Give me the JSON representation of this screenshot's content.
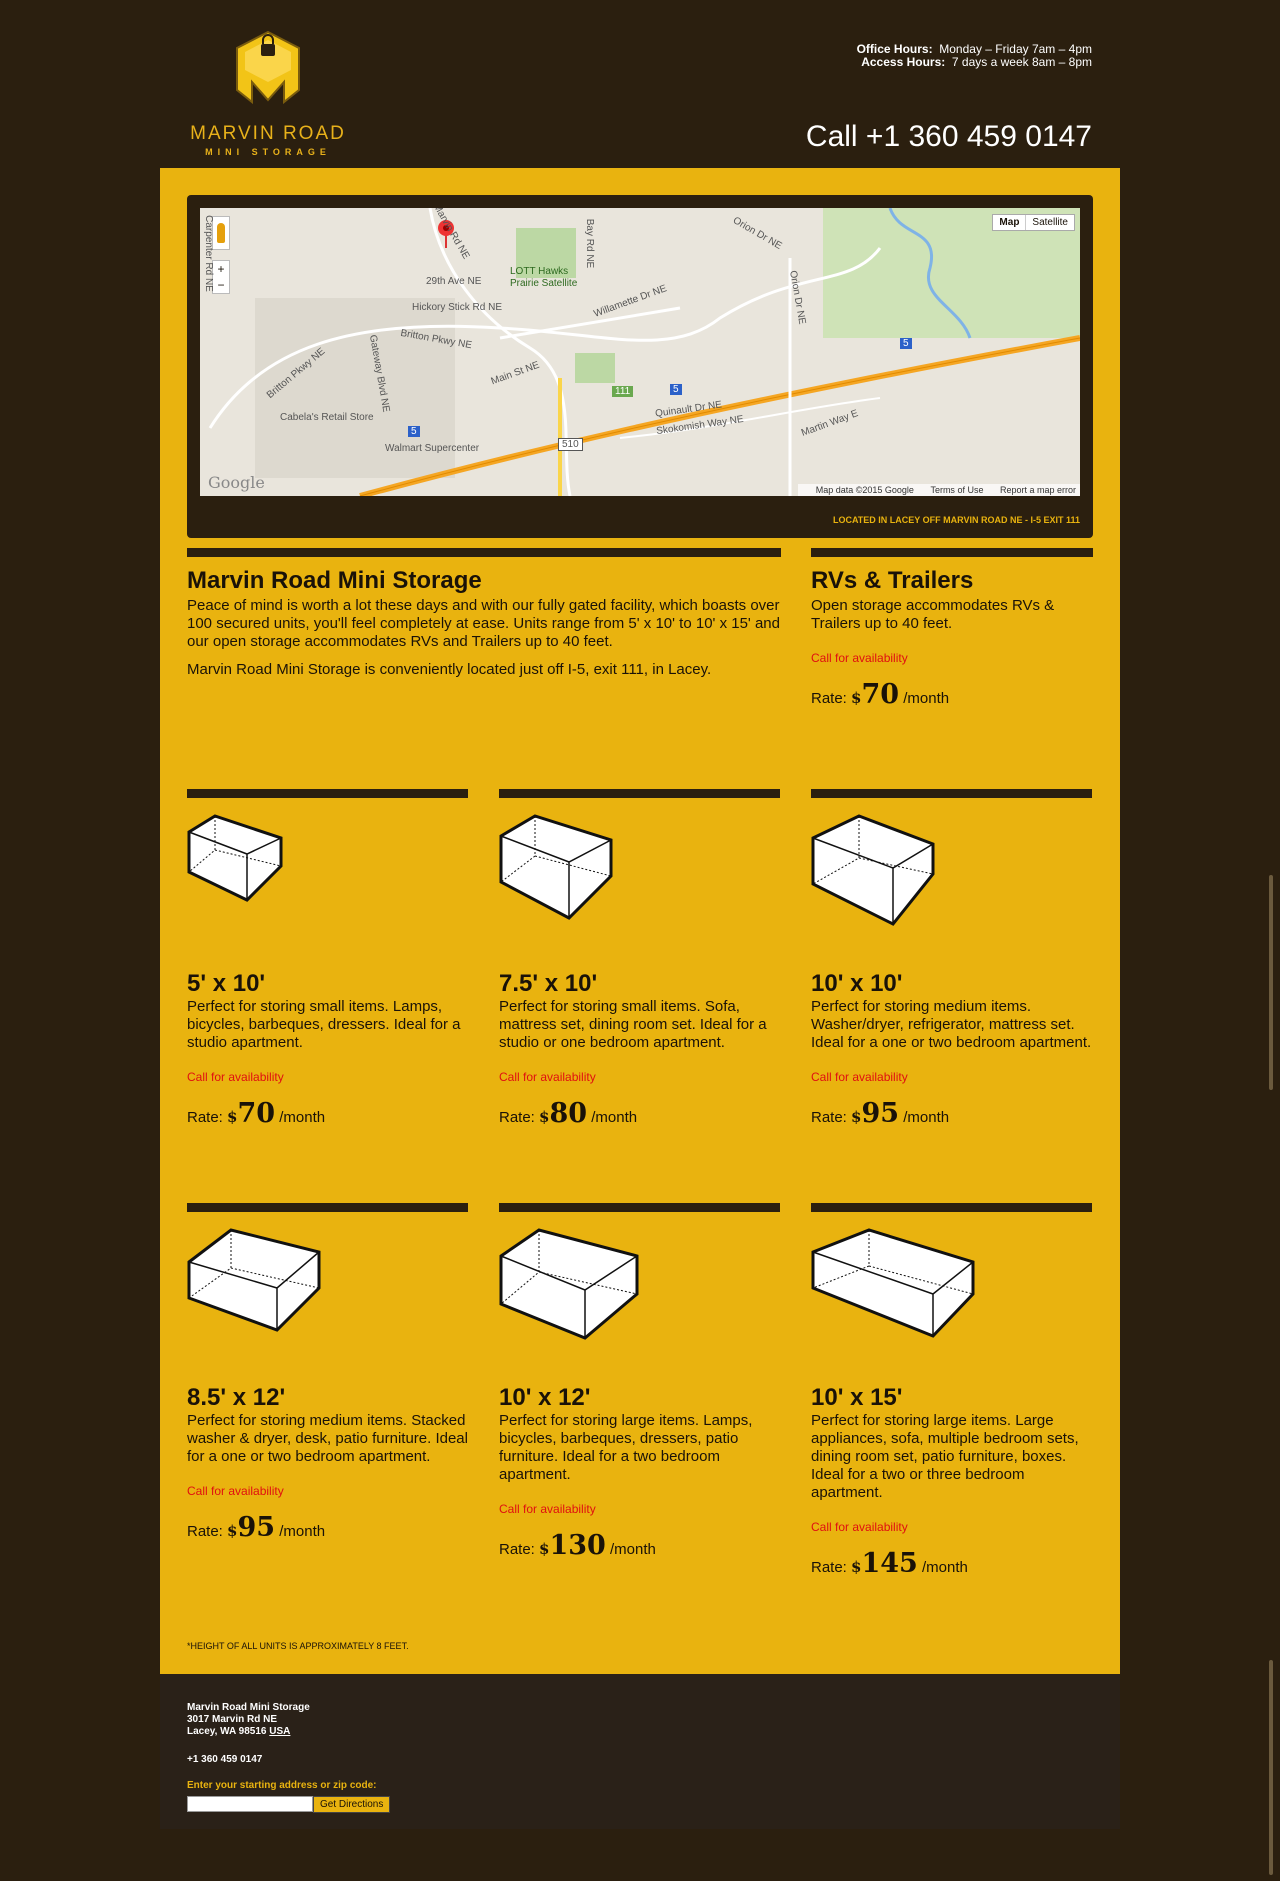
{
  "header": {
    "logo_name": "MARVIN ROAD",
    "logo_sub": "MINI STORAGE",
    "office_hours_label": "Office Hours:",
    "office_hours_value": "Monday – Friday 7am – 4pm",
    "access_hours_label": "Access Hours:",
    "access_hours_value": "7 days a week 8am – 8pm",
    "phone": "Call +1 360 459 0147"
  },
  "map": {
    "toggle_map": "Map",
    "toggle_satellite": "Satellite",
    "zoom_in": "+",
    "zoom_out": "−",
    "google": "Google",
    "credit_data": "Map data ©2015 Google",
    "credit_terms": "Terms of Use",
    "credit_report": "Report a map error",
    "caption": "LOCATED IN LACEY OFF MARVIN ROAD NE - I-5 EXIT 111",
    "labels": {
      "lott": "LOTT Hawks",
      "lott2": "Prairie Satellite",
      "ave29": "29th Ave NE",
      "hickory": "Hickory Stick Rd NE",
      "britton": "Britton Pkwy NE",
      "britton2": "Britton Pkwy NE",
      "gateway": "Gateway Blvd NE",
      "main": "Main St NE",
      "willamette": "Willamette Dr NE",
      "orion": "Orion Dr NE",
      "orion2": "Orion Dr NE",
      "quinault": "Quinault Dr NE",
      "skokomish": "Skokomish Way NE",
      "martin": "Martin Way E",
      "cabelas": "Cabela's Retail Store",
      "walmart": "Walmart Supercenter",
      "baybay": "Bay Rd NE",
      "marvin": "Marvin Rd NE",
      "carpenter": "Carpenter Rd NE",
      "exit": "111",
      "hw510": "510",
      "i5": "5"
    }
  },
  "about": {
    "title": "Marvin Road Mini Storage",
    "p1": "Peace of mind is worth a lot these days and with our fully gated facility, which boasts over 100 secured units, you'll feel completely at ease. Units range from 5' x 10' to 10' x 15' and our open storage accommodates RVs and Trailers up to 40 feet.",
    "p2": "Marvin Road Mini Storage is conveniently located just off I-5, exit 111, in Lacey."
  },
  "rvs": {
    "title": "RVs & Trailers",
    "desc": "Open storage accommodates RVs & Trailers up to 40 feet.",
    "call": "Call for availability",
    "rate_label": "Rate:",
    "dollar": "$",
    "amount": "70",
    "per": "/month"
  },
  "units": [
    {
      "size": "5' x 10'",
      "desc": "Perfect for storing small items. Lamps, bicycles, barbeques, dressers. Ideal for a studio apartment.",
      "call": "Call for availability",
      "rate_label": "Rate:",
      "dollar": "$",
      "amount": "70",
      "per": "/month"
    },
    {
      "size": "7.5' x 10'",
      "desc": "Perfect for storing small items. Sofa, mattress set, dining room set. Ideal for a studio or one bedroom apartment.",
      "call": "Call for availability",
      "rate_label": "Rate:",
      "dollar": "$",
      "amount": "80",
      "per": "/month"
    },
    {
      "size": "10' x 10'",
      "desc": "Perfect for storing medium items. Washer/dryer, refrigerator, mattress set. Ideal for a one or two bedroom apartment.",
      "call": "Call for availability",
      "rate_label": "Rate:",
      "dollar": "$",
      "amount": "95",
      "per": "/month"
    },
    {
      "size": "8.5' x 12'",
      "desc": "Perfect for storing medium items. Stacked washer & dryer, desk, patio furniture. Ideal for a one or two bedroom apartment.",
      "call": "Call for availability",
      "rate_label": "Rate:",
      "dollar": "$",
      "amount": "95",
      "per": "/month"
    },
    {
      "size": "10' x 12'",
      "desc": "Perfect for storing large items. Lamps, bicycles, barbeques, dressers, patio furniture. Ideal for a two bedroom apartment.",
      "call": "Call for availability",
      "rate_label": "Rate:",
      "dollar": "$",
      "amount": "130",
      "per": "/month"
    },
    {
      "size": "10' x 15'",
      "desc": "Perfect for storing large items. Large appliances, sofa, multiple bedroom sets, dining room set, patio furniture, boxes. Ideal for a two or three bedroom apartment.",
      "call": "Call for availability",
      "rate_label": "Rate:",
      "dollar": "$",
      "amount": "145",
      "per": "/month"
    }
  ],
  "footnote": "*HEIGHT OF ALL UNITS IS APPROXIMATELY 8 FEET.",
  "footer": {
    "name": "Marvin Road Mini Storage",
    "street": "3017 Marvin Rd NE",
    "city": "Lacey, WA 98516",
    "country": "USA",
    "phone": "+1 360 459 0147",
    "prompt": "Enter your starting address or zip code:",
    "input_value": "",
    "button": "Get Directions"
  },
  "colors": {
    "page_bg": "#2b1f0f",
    "accent": "#e9b30f",
    "call_red": "#e01010"
  }
}
